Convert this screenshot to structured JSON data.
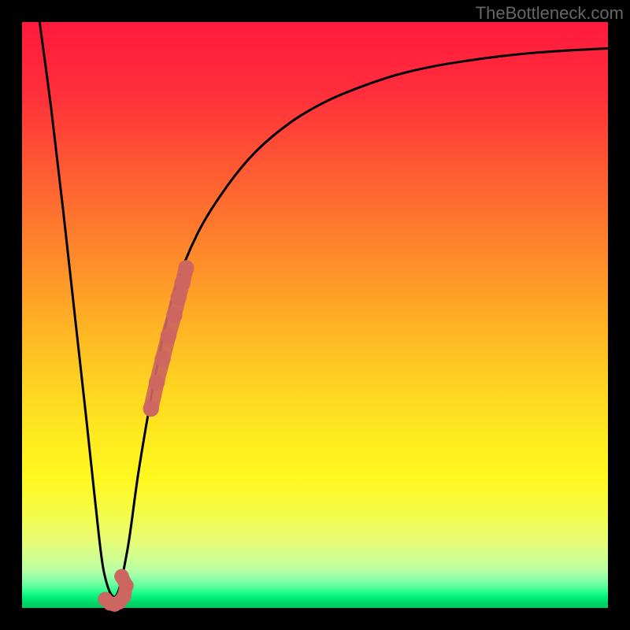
{
  "watermark": "TheBottleneck.com",
  "chart_data": {
    "type": "line",
    "title": "",
    "xlabel": "",
    "ylabel": "",
    "xlim": [
      0,
      100
    ],
    "ylim": [
      0,
      100
    ],
    "series": [
      {
        "name": "bottleneck-curve",
        "x": [
          3,
          5,
          7,
          9,
          11,
          12.5,
          14,
          16,
          18,
          20,
          23,
          26,
          30,
          35,
          40,
          46,
          52,
          58,
          64,
          70,
          76,
          82,
          88,
          94,
          100
        ],
        "y": [
          100,
          85,
          68,
          50,
          32,
          18,
          6,
          2,
          10,
          24,
          41,
          54,
          64,
          72,
          78,
          83,
          86.5,
          89,
          91,
          92.4,
          93.4,
          94.2,
          94.8,
          95.2,
          95.5
        ]
      }
    ],
    "markers": [
      {
        "name": "right-branch-accent",
        "color": "#cc6660",
        "x": [
          22,
          23,
          24,
          25,
          26,
          26.7,
          27.4,
          28
        ],
        "y": [
          34,
          38.5,
          42.5,
          46.5,
          50,
          53,
          55.5,
          58
        ],
        "size": 12
      },
      {
        "name": "valley-accent",
        "color": "#cc6660",
        "x": [
          14.2,
          15,
          15.8,
          16.6,
          17.4,
          17.8,
          17.0
        ],
        "y": [
          1.5,
          0.8,
          0.6,
          1.0,
          2.0,
          3.8,
          5.4
        ],
        "size": 11
      }
    ],
    "colors": {
      "curve": "#000000",
      "accent": "#cc6660"
    }
  }
}
